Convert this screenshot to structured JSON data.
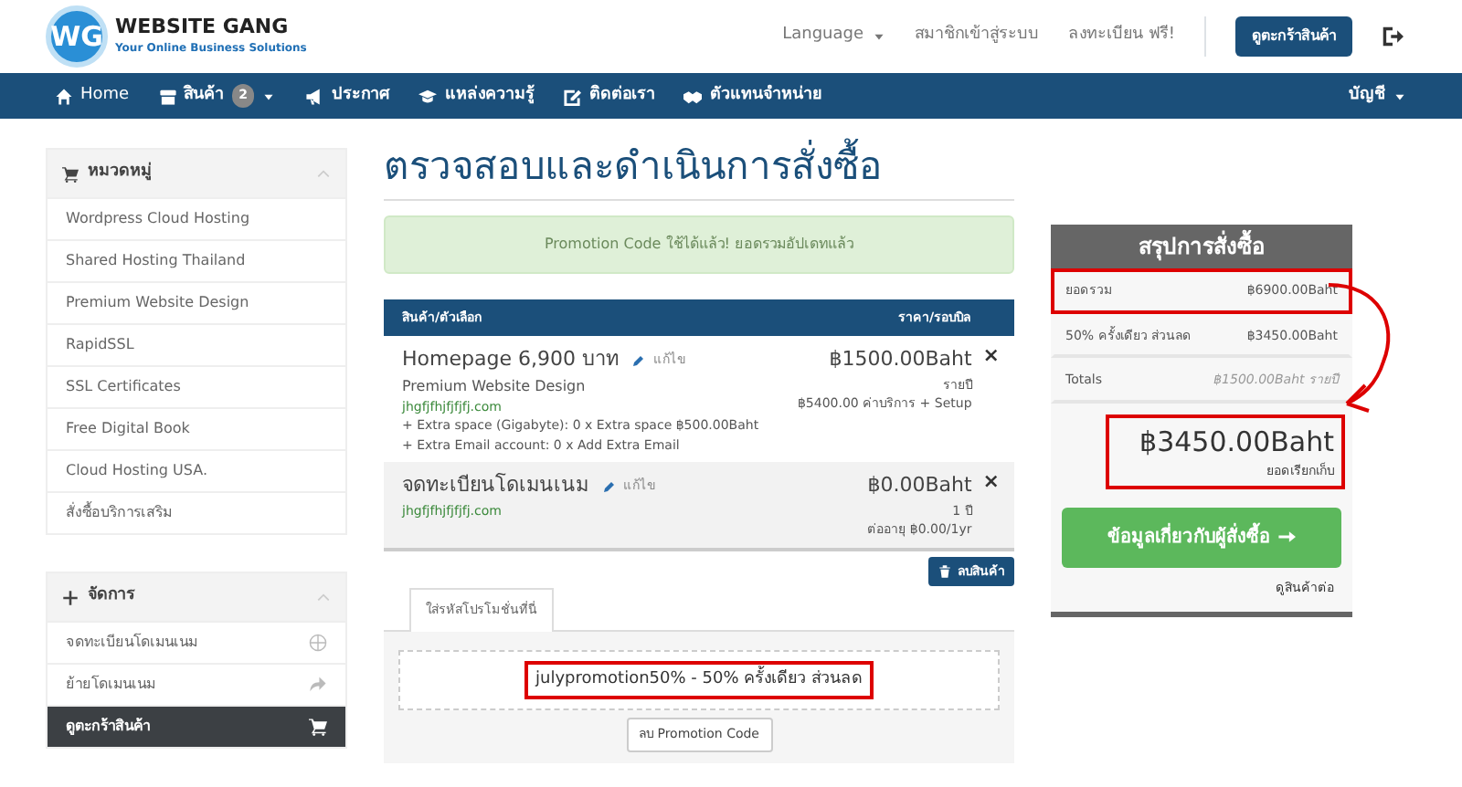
{
  "header": {
    "logo_mark": "WG",
    "brand": "WEBSITE GANG",
    "tagline": "Your Online Business Solutions",
    "links": [
      {
        "label": "Language",
        "dropdown": true
      },
      {
        "label": "สมาชิกเข้าสู่ระบบ",
        "dropdown": false
      },
      {
        "label": "ลงทะเบียน ฟรี!",
        "dropdown": false
      }
    ],
    "cart_button": "ดูตะกร้าสินค้า"
  },
  "navbar": {
    "items": [
      {
        "label": "Home",
        "dropdown": false
      },
      {
        "label": "สินค้า",
        "badge": "2",
        "dropdown": true
      },
      {
        "label": "ประกาศ",
        "dropdown": false
      },
      {
        "label": "แหล่งความรู้",
        "dropdown": false
      },
      {
        "label": "ติดต่อเรา",
        "dropdown": false
      },
      {
        "label": "ตัวแทนจำหน่าย",
        "dropdown": false
      }
    ],
    "account": "บัญชี"
  },
  "sidebar": {
    "panels": [
      {
        "title": "หมวดหมู่",
        "items": [
          {
            "label": "Wordpress Cloud Hosting",
            "selected": false
          },
          {
            "label": "Shared Hosting Thailand",
            "selected": false
          },
          {
            "label": "Premium Website Design",
            "selected": false
          },
          {
            "label": "RapidSSL",
            "selected": false
          },
          {
            "label": "SSL Certificates",
            "selected": false
          },
          {
            "label": "Free Digital Book",
            "selected": false
          },
          {
            "label": "Cloud Hosting USA.",
            "selected": false
          },
          {
            "label": "สั่งซื้อบริการเสริม",
            "selected": false
          }
        ]
      },
      {
        "title": "จัดการ",
        "items": [
          {
            "label": "จดทะเบียนโดเมนเนม",
            "selected": false
          },
          {
            "label": "ย้ายโดเมนเนม",
            "selected": false
          },
          {
            "label": "ดูตะกร้าสินค้า",
            "selected": true
          }
        ]
      }
    ]
  },
  "page_title": "ตรวจสอบและดำเนินการสั่งซื้อ",
  "alert": "Promotion Code ใช้ได้แล้ว! ยอดรวมอัปเดทแล้ว",
  "cart": {
    "columns": [
      "สินค้า/ตัวเลือก",
      "ราคา/รอบบิล"
    ],
    "items": [
      {
        "name": "Homepage 6,900 บาท",
        "edit": "แก้ไข",
        "group": "Premium Website Design",
        "domain": "jhgfjfhjfjfjfj.com",
        "options": [
          "+ Extra space (Gigabyte): 0 x Extra space ฿500.00Baht",
          "+ Extra Email account: 0 x Add Extra Email"
        ],
        "price": "฿1500.00Baht",
        "cycle": "รายปี",
        "note": "฿5400.00 ค่าบริการ + Setup",
        "shaded": false,
        "remove": "×"
      },
      {
        "name": "จดทะเบียนโดเมนเนม",
        "edit": "แก้ไข",
        "domain": "jhgfjfhjfjfjfj.com",
        "price": "฿0.00Baht",
        "cycle": "1 ปี",
        "note": "ต่ออายุ ฿0.00/1yr",
        "shaded": true,
        "remove": "×"
      }
    ],
    "empty_button": "ลบสินค้า"
  },
  "promo": {
    "tab": "ใส่รหัสโปรโมชั่นที่นี่",
    "code": "julypromotion50% - 50% ครั้งเดียว ส่วนลด",
    "highlighted": true,
    "remove_button": "ลบ Promotion Code"
  },
  "summary": {
    "title": "สรุปการสั่งซื้อ",
    "rows": [
      {
        "label": "ยอดรวม",
        "value": "฿6900.00Baht",
        "italic": false,
        "highlighted": true
      },
      {
        "label": "50% ครั้งเดียว ส่วนลด",
        "value": "฿3450.00Baht",
        "italic": false,
        "highlighted": false
      },
      {
        "label": "Totals",
        "value": "฿1500.00Baht รายปี",
        "italic": true,
        "highlighted": false
      }
    ],
    "total": "฿3450.00Baht",
    "total_label": "ยอดเรียกเก็บ",
    "total_highlighted": true,
    "checkout_button": "ข้อมูลเกี่ยวกับผู้สั่งซื้อ",
    "continue_link": "ดูสินค้าต่อ"
  }
}
